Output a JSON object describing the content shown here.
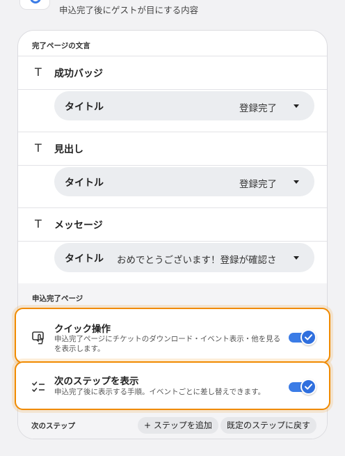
{
  "header": {
    "subtitle": "申込完了後にゲストが目にする内容",
    "icon": "status-icon"
  },
  "completion_text": {
    "section_title": "完了ページの文言",
    "fields": [
      {
        "label": "成功バッジ",
        "icon": "text-icon",
        "select_label": "タイトル",
        "select_value": "登録完了"
      },
      {
        "label": "見出し",
        "icon": "text-icon",
        "select_label": "タイトル",
        "select_value": "登録完了"
      },
      {
        "label": "メッセージ",
        "icon": "text-icon",
        "select_label": "タイトル",
        "select_value": "おめでとうございます！登録が確認さ"
      }
    ]
  },
  "completion_page": {
    "section_title": "申込完了ページ",
    "options": [
      {
        "title": "クイック操作",
        "description": "申込完了ページにチケットのダウンロード・イベント表示・他を見るを表示します。",
        "icon": "tap-icon",
        "enabled": true
      },
      {
        "title": "次のステップを表示",
        "description": "申込完了後に表示する手順。イベントごとに差し替えできます。",
        "icon": "checklist-icon",
        "enabled": true
      }
    ]
  },
  "next_steps": {
    "label": "次のステップ",
    "add_button": "+ ステップを追加",
    "reset_button": "既定のステップに戻す"
  },
  "colors": {
    "accent": "#3b7ce6",
    "highlight": "#f08a00"
  }
}
